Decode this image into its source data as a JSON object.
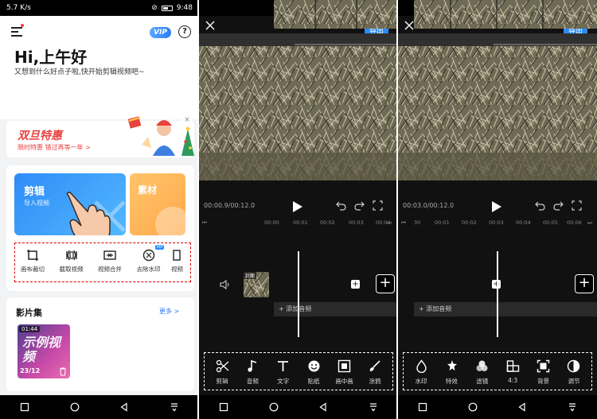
{
  "status": {
    "left": "5.7 K/s",
    "time": "9:48"
  },
  "home": {
    "vip": "VIP",
    "help": "?",
    "greeting": "Hi,上午好",
    "subtitle": "又想到什么好点子啦,快开始剪辑视频吧~",
    "promo": {
      "title": "双旦特惠",
      "subtitle": "限时特惠  错过再等一年 >",
      "close": "×"
    },
    "edit_card": {
      "title": "剪辑",
      "subtitle": "导入视频"
    },
    "material_card": {
      "title": "素材"
    },
    "tools": [
      {
        "label": "画布裁切",
        "icon": "crop-icon"
      },
      {
        "label": "截取视频",
        "icon": "trim-icon"
      },
      {
        "label": "视频合并",
        "icon": "merge-icon"
      },
      {
        "label": "去除水印",
        "icon": "watermark-remove-icon",
        "badge": "VIP"
      },
      {
        "label": "视频",
        "icon": "video-icon"
      }
    ],
    "films": {
      "title": "影片集",
      "more": "更多 >",
      "item": {
        "duration": "01:44",
        "text": "示例视频",
        "date": "23/12"
      }
    }
  },
  "editor1": {
    "export": "导出",
    "time": "00:00.9/00:12.0",
    "ruler": [
      "00:00",
      "00:01",
      "00:02",
      "00:03",
      "00:04"
    ],
    "cover": "封面",
    "add_audio": "+ 添加音频",
    "tools": [
      {
        "label": "剪辑",
        "icon": "scissors-icon"
      },
      {
        "label": "音频",
        "icon": "music-icon"
      },
      {
        "label": "文字",
        "icon": "text-icon"
      },
      {
        "label": "贴纸",
        "icon": "sticker-icon"
      },
      {
        "label": "画中画",
        "icon": "pip-icon"
      },
      {
        "label": "涂鸦",
        "icon": "brush-icon"
      }
    ]
  },
  "editor2": {
    "export": "导出",
    "time": "00:03.0/00:12.0",
    "ruler": [
      "30",
      "00:01",
      "00:02",
      "00:03",
      "00:04",
      "00:05",
      "00:06"
    ],
    "add_audio": "+ 添加音频",
    "tools": [
      {
        "label": "水印",
        "icon": "watermark-icon"
      },
      {
        "label": "特效",
        "icon": "effects-icon"
      },
      {
        "label": "滤镜",
        "icon": "filter-icon"
      },
      {
        "label": "4:3",
        "icon": "ratio-icon"
      },
      {
        "label": "背景",
        "icon": "background-icon"
      },
      {
        "label": "调节",
        "icon": "adjust-icon"
      }
    ]
  },
  "colors": {
    "accent": "#2a8cf6",
    "promo": "#e8423f",
    "material": "#ffb354"
  }
}
